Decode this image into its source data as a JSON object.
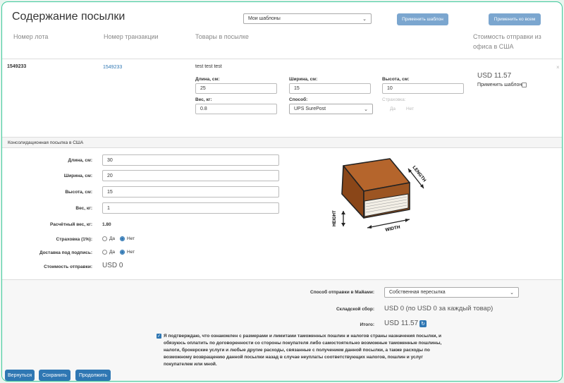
{
  "page": {
    "title": "Содержание посылки",
    "templates_select": "Мои шаблоны",
    "apply_template_btn": "Применить шаблон",
    "apply_all_btn": "Применить ко всем"
  },
  "columns": {
    "lot": "Номер лота",
    "transaction": "Номер транзакции",
    "goods": "Товары в посылке",
    "shipping_line1": "Стоимость отправки из",
    "shipping_line2": "офиса в США"
  },
  "item": {
    "lot_number": "1549233",
    "transaction_link": "1549233",
    "goods_title": "test test test",
    "length_label": "Длина, см:",
    "length_value": "25",
    "width_label": "Ширина, см:",
    "width_value": "15",
    "height_label": "Высота, см:",
    "height_value": "10",
    "weight_label": "Вес, кг:",
    "weight_value": "0.8",
    "method_label": "Способ:",
    "method_value": "UPS SurePost",
    "insurance_label": "Страховка:",
    "insurance_yes": "Да",
    "insurance_no": "Нет",
    "price": "USD 11.57",
    "apply_template_label": "Применить шаблон",
    "close": "×"
  },
  "consolidated": {
    "section_title": "Консолидационная посылка в США",
    "length_label": "Длина, см:",
    "length_value": "30",
    "width_label": "Ширина, см:",
    "width_value": "20",
    "height_label": "Высота, см:",
    "height_value": "15",
    "weight_label": "Вес, кг:",
    "weight_value": "1",
    "calc_weight_label": "Расчётный вес, кг:",
    "calc_weight_value": "1.80",
    "insurance_label": "Страховка (1%):",
    "signature_label": "Доставка под подпись:",
    "yes": "Да",
    "no": "Нет",
    "cost_label": "Стоимость отправки:",
    "cost_value": "USD 0",
    "diagram": {
      "length": "LENGTH",
      "width": "WIDTH",
      "height": "HEIGHT"
    }
  },
  "summary": {
    "method_label": "Способ отправки в Майами:",
    "method_value": "Собственная пересылка",
    "warehouse_label": "Складской сбор:",
    "warehouse_value": "USD 0 (по USD 0 за каждый товар)",
    "total_label": "Итого:",
    "total_value": "USD 11.57",
    "confirm_line1": "Я подтверждаю, что ознакомлен с размерами и лимитами таможенных пошлин и налогов страны назначения посылки, и",
    "confirm_line2": "обязуюсь оплатить по договоренности со стороны покупателя либо самостоятельно возможные таможенные пошлины,",
    "confirm_line3": "налоги, брокерские услуги и любые другие расходы, связанные с получением данной посылки, а также расходы по",
    "confirm_line4": "возможному возвращению данной посылки назад в случае неуплаты соответствующих налогов, пошлин и услуг",
    "confirm_line5": "покупателем или мной."
  },
  "footer": {
    "back": "Вернуться",
    "save": "Сохранить",
    "continue": "Продолжить"
  },
  "colors": {
    "primary": "#2f77b3",
    "primary_light": "#7ba6cf",
    "frame": "#3ec99a"
  }
}
